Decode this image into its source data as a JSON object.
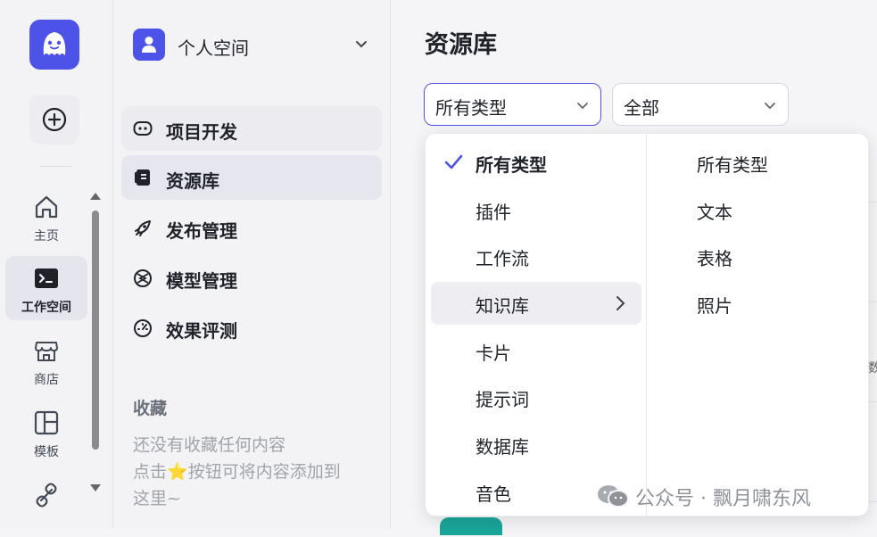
{
  "rail": {
    "items": [
      {
        "label": "主页",
        "icon": "home-icon"
      },
      {
        "label": "工作空间",
        "icon": "terminal-icon",
        "active": true
      },
      {
        "label": "商店",
        "icon": "store-icon"
      },
      {
        "label": "模板",
        "icon": "template-icon"
      }
    ]
  },
  "space": {
    "name": "个人空间"
  },
  "nav": {
    "items": [
      {
        "label": "项目开发",
        "icon": "bot-icon"
      },
      {
        "label": "资源库",
        "icon": "library-icon",
        "selected": true
      },
      {
        "label": "发布管理",
        "icon": "rocket-icon"
      },
      {
        "label": "模型管理",
        "icon": "model-icon"
      },
      {
        "label": "效果评测",
        "icon": "gauge-icon"
      }
    ],
    "favorites_title": "收藏",
    "favorites_empty_line1": "还没有收藏任何内容",
    "favorites_empty_line2_pre": "点击",
    "favorites_empty_star": "⭐",
    "favorites_empty_line2_post": "按钮可将内容添加到",
    "favorites_empty_line3": "这里~"
  },
  "main": {
    "title": "资源库",
    "type_filter": {
      "value": "所有类型"
    },
    "scope_filter": {
      "value": "全部"
    },
    "bg_partial_text": "数"
  },
  "cascader": {
    "level1": [
      {
        "label": "所有类型",
        "checked": true
      },
      {
        "label": "插件"
      },
      {
        "label": "工作流"
      },
      {
        "label": "知识库",
        "expanded": true
      },
      {
        "label": "卡片"
      },
      {
        "label": "提示词"
      },
      {
        "label": "数据库"
      },
      {
        "label": "音色"
      }
    ],
    "level2": [
      {
        "label": "所有类型"
      },
      {
        "label": "文本"
      },
      {
        "label": "表格"
      },
      {
        "label": "照片"
      }
    ]
  },
  "watermark": {
    "text": "公众号 · 飘月啸东风"
  },
  "colors": {
    "brand": "#4d53e8",
    "teal": "#1aa59a"
  }
}
